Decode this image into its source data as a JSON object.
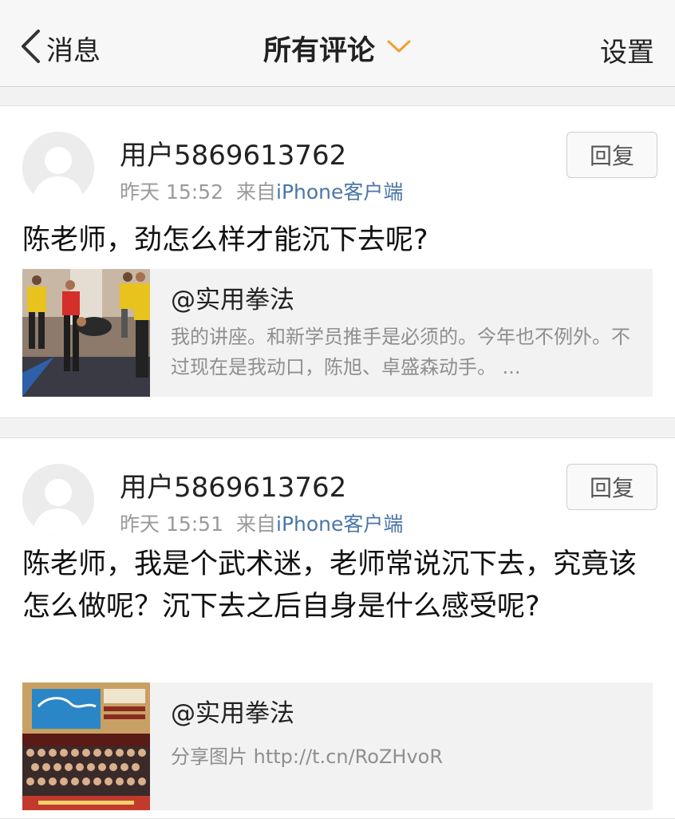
{
  "nav": {
    "back_label": "消息",
    "title": "所有评论",
    "settings_label": "设置",
    "accent_color": "#f0a030"
  },
  "comments": [
    {
      "username": "用户5869613762",
      "time": "昨天 15:52",
      "source_prefix": "来自",
      "source": "iPhone客户端",
      "reply_label": "回复",
      "text": "陈老师，劲怎么样才能沉下去呢?",
      "ref": {
        "author": "@实用拳法",
        "desc": "我的讲座。和新学员推手是必须的。今年也不例外。不过现在是我动口，陈旭、卓盛森动手。 ..."
      }
    },
    {
      "username": "用户5869613762",
      "time": "昨天 15:51",
      "source_prefix": "来自",
      "source": "iPhone客户端",
      "reply_label": "回复",
      "text": "陈老师，我是个武术迷，老师常说沉下去，究竟该怎么做呢？沉下去之后自身是什么感受呢?",
      "ref": {
        "author": "@实用拳法",
        "desc": "分享图片 http://t.cn/RoZHvoR"
      }
    }
  ]
}
